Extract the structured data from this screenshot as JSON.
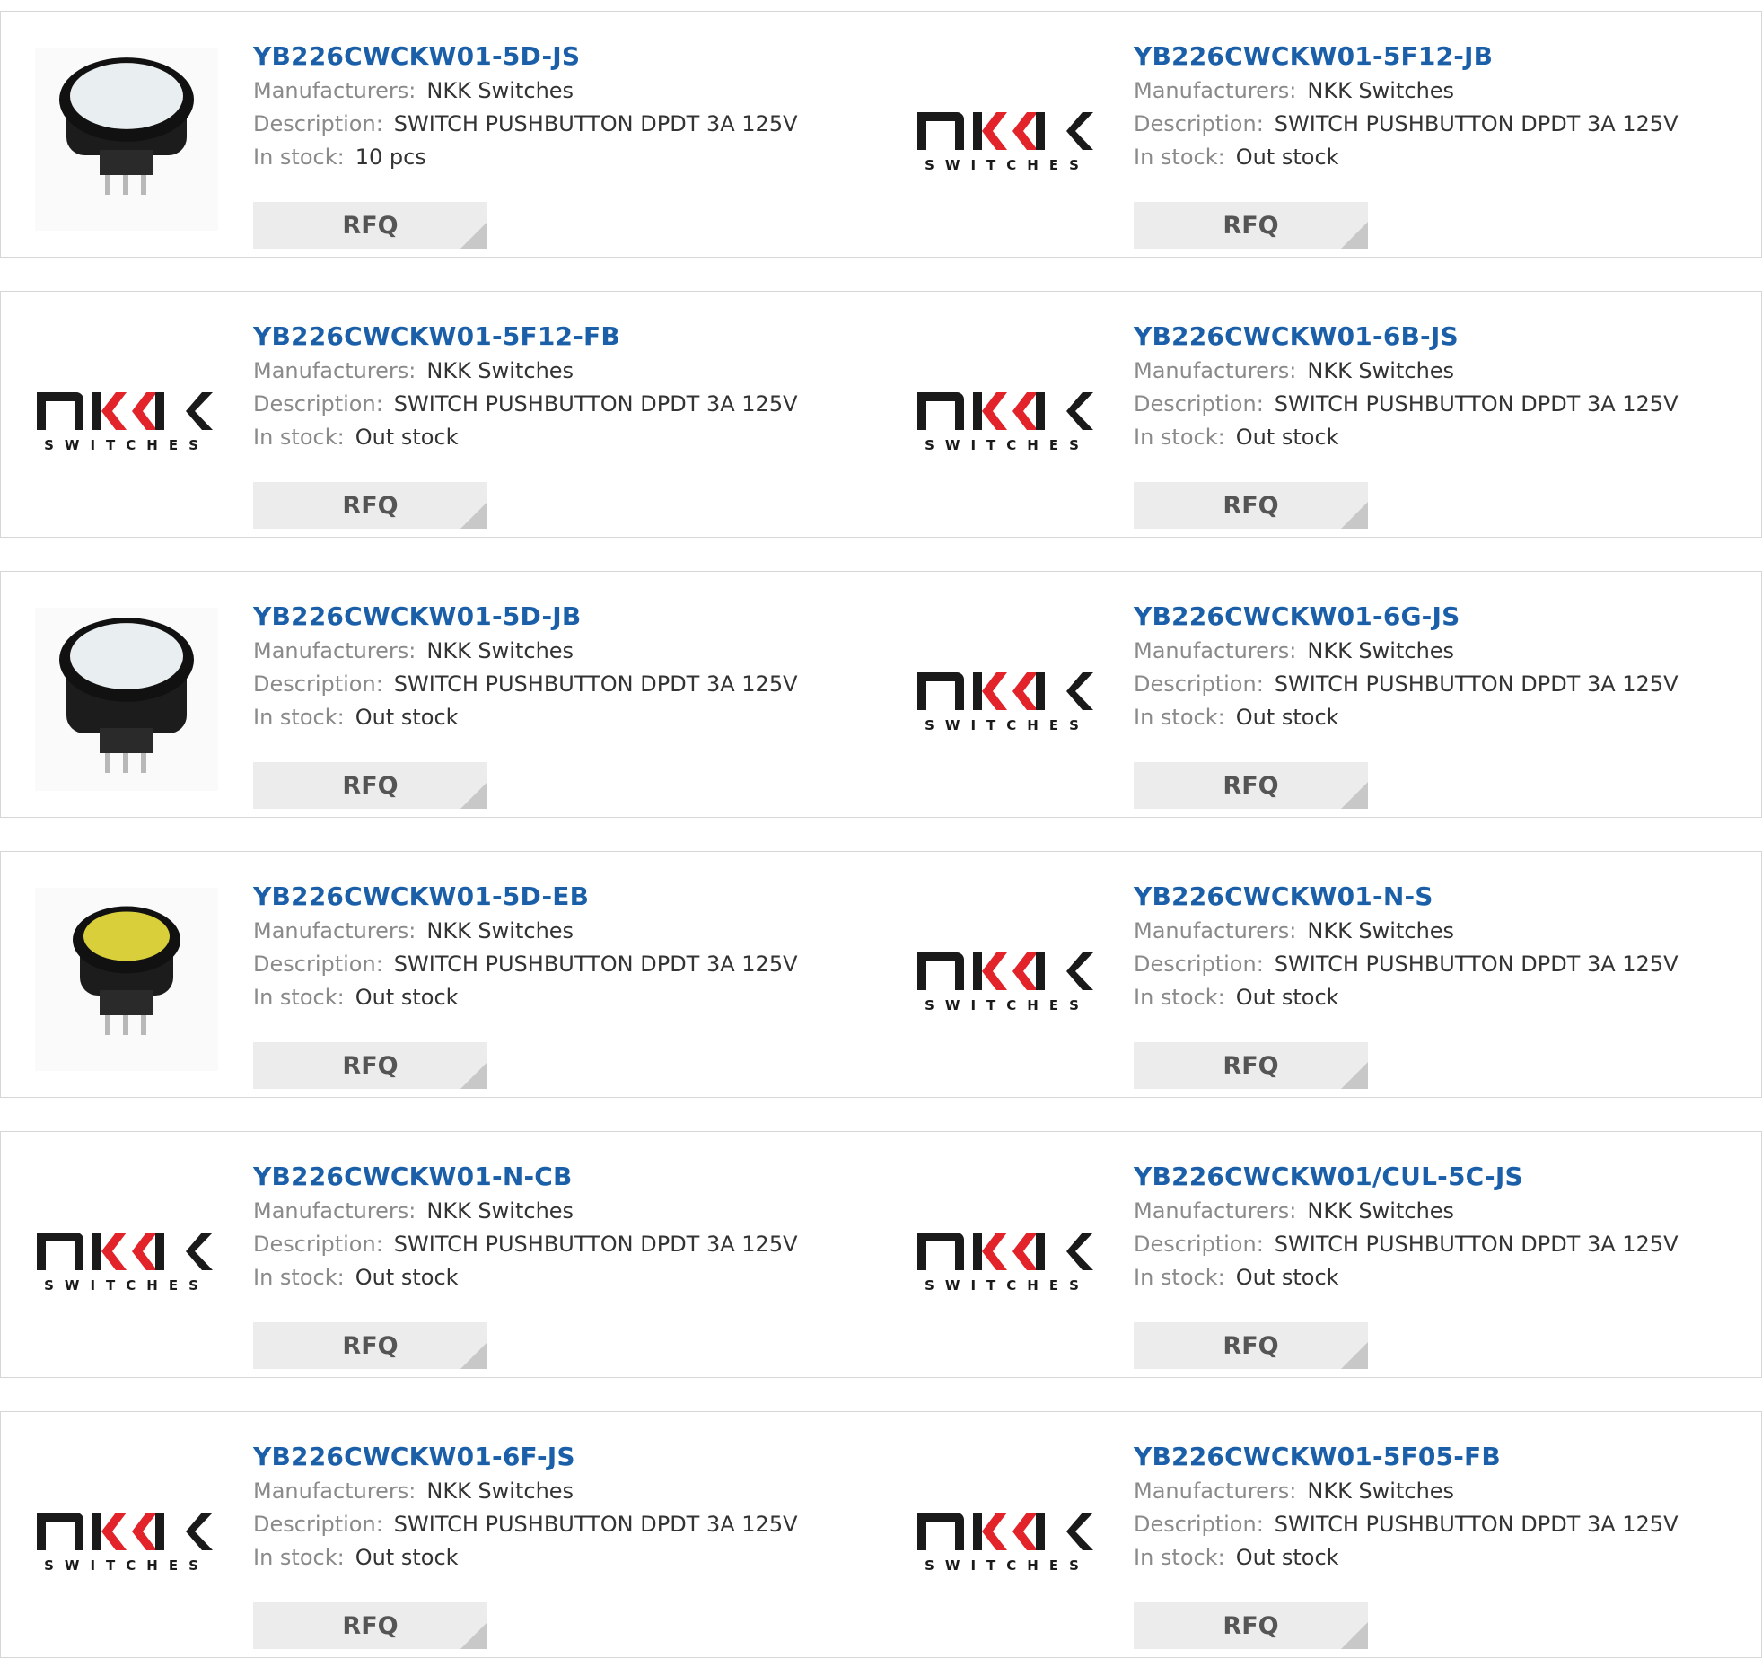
{
  "labels": {
    "manufacturer": "Manufacturers:",
    "description": "Description:",
    "stock": "In stock:",
    "rfq": "RFQ"
  },
  "logo": {
    "big": "nKK",
    "small": "SWITCHES"
  },
  "colors": {
    "link": "#1a5fa8",
    "button_bg": "#ececec",
    "button_corner": "#c8c8c8",
    "border": "#d6d6d6",
    "logo_red": "#e2232a"
  },
  "products": [
    {
      "part": "YB226CWCKW01-5D-JS",
      "manufacturer": "NKK Switches",
      "description": "SWITCH PUSHBUTTON DPDT 3A 125V",
      "stock": "10 pcs",
      "image": "white-pushbutton-photo"
    },
    {
      "part": "YB226CWCKW01-5F12-JB",
      "manufacturer": "NKK Switches",
      "description": "SWITCH PUSHBUTTON DPDT 3A 125V",
      "stock": "Out stock",
      "image": "nkk-logo"
    },
    {
      "part": "YB226CWCKW01-5F12-FB",
      "manufacturer": "NKK Switches",
      "description": "SWITCH PUSHBUTTON DPDT 3A 125V",
      "stock": "Out stock",
      "image": "nkk-logo"
    },
    {
      "part": "YB226CWCKW01-6B-JS",
      "manufacturer": "NKK Switches",
      "description": "SWITCH PUSHBUTTON DPDT 3A 125V",
      "stock": "Out stock",
      "image": "nkk-logo"
    },
    {
      "part": "YB226CWCKW01-5D-JB",
      "manufacturer": "NKK Switches",
      "description": "SWITCH PUSHBUTTON DPDT 3A 125V",
      "stock": "Out stock",
      "image": "white-pushbutton-tall-photo"
    },
    {
      "part": "YB226CWCKW01-6G-JS",
      "manufacturer": "NKK Switches",
      "description": "SWITCH PUSHBUTTON DPDT 3A 125V",
      "stock": "Out stock",
      "image": "nkk-logo"
    },
    {
      "part": "YB226CWCKW01-5D-EB",
      "manufacturer": "NKK Switches",
      "description": "SWITCH PUSHBUTTON DPDT 3A 125V",
      "stock": "Out stock",
      "image": "yellow-pushbutton-photo"
    },
    {
      "part": "YB226CWCKW01-N-S",
      "manufacturer": "NKK Switches",
      "description": "SWITCH PUSHBUTTON DPDT 3A 125V",
      "stock": "Out stock",
      "image": "nkk-logo"
    },
    {
      "part": "YB226CWCKW01-N-CB",
      "manufacturer": "NKK Switches",
      "description": "SWITCH PUSHBUTTON DPDT 3A 125V",
      "stock": "Out stock",
      "image": "nkk-logo"
    },
    {
      "part": "YB226CWCKW01/CUL-5C-JS",
      "manufacturer": "NKK Switches",
      "description": "SWITCH PUSHBUTTON DPDT 3A 125V",
      "stock": "Out stock",
      "image": "nkk-logo"
    },
    {
      "part": "YB226CWCKW01-6F-JS",
      "manufacturer": "NKK Switches",
      "description": "SWITCH PUSHBUTTON DPDT 3A 125V",
      "stock": "Out stock",
      "image": "nkk-logo"
    },
    {
      "part": "YB226CWCKW01-5F05-FB",
      "manufacturer": "NKK Switches",
      "description": "SWITCH PUSHBUTTON DPDT 3A 125V",
      "stock": "Out stock",
      "image": "nkk-logo"
    }
  ]
}
